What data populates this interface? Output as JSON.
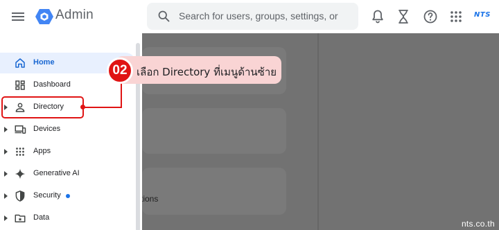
{
  "header": {
    "app_title": "Admin",
    "search_placeholder": "Search for users, groups, settings, or",
    "brand_mark": "NTS",
    "icons": [
      "menu-icon",
      "google-admin-logo",
      "search-icon",
      "notifications-bell-icon",
      "tasks-hourglass-icon",
      "help-icon",
      "apps-grid-icon"
    ]
  },
  "sidebar": {
    "items": [
      {
        "label": "Home",
        "icon": "home-icon",
        "active": true,
        "expandable": false
      },
      {
        "label": "Dashboard",
        "icon": "dashboard-icon",
        "active": false,
        "expandable": false
      },
      {
        "label": "Directory",
        "icon": "person-icon",
        "active": false,
        "expandable": true
      },
      {
        "label": "Devices",
        "icon": "devices-icon",
        "active": false,
        "expandable": true
      },
      {
        "label": "Apps",
        "icon": "apps-grid-icon",
        "active": false,
        "expandable": true
      },
      {
        "label": "Generative AI",
        "icon": "sparkle-icon",
        "active": false,
        "expandable": true
      },
      {
        "label": "Security",
        "icon": "shield-icon",
        "active": false,
        "expandable": true,
        "badge_dot": true
      },
      {
        "label": "Data",
        "icon": "folder-star-icon",
        "active": false,
        "expandable": true
      }
    ]
  },
  "main": {
    "card_text_fragment": "ctions"
  },
  "annotation": {
    "step_number": "02",
    "text": "เลือก Directory ที่เมนูด้านซ้าย",
    "highlight_color": "#e01414",
    "callout_color": "#f9d4d4"
  },
  "watermark": "nts.co.th",
  "colors": {
    "accent": "#1a73e8",
    "active_bg": "#e8f0fe",
    "overlay": "#727272"
  }
}
